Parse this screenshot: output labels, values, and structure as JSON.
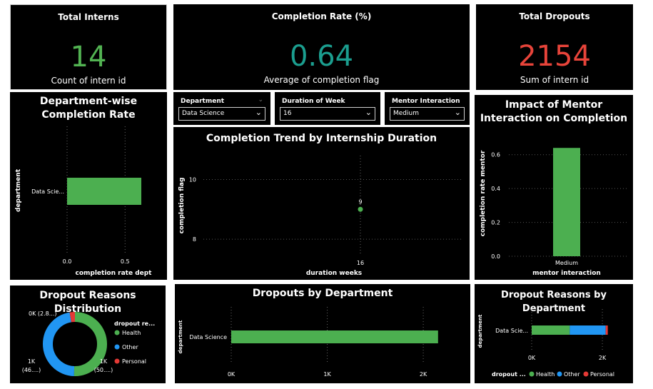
{
  "kpis": {
    "total_interns": {
      "title": "Total Interns",
      "value": "14",
      "subtitle": "Count of intern id",
      "color": "#52b352"
    },
    "completion_rate": {
      "title": "Completion Rate (%)",
      "value": "0.64",
      "subtitle": "Average of completion flag",
      "color": "#1b9e8f"
    },
    "total_dropouts": {
      "title": "Total Dropouts",
      "value": "2154",
      "subtitle": "Sum of intern id",
      "color": "#e8443a"
    }
  },
  "slicers": {
    "department": {
      "label": "Department",
      "value": "Data Science"
    },
    "duration": {
      "label": "Duration of Week",
      "value": "16"
    },
    "mentor": {
      "label": "Mentor Interaction",
      "value": "Medium"
    }
  },
  "colors": {
    "green": "#4caf50",
    "blue": "#2196f3",
    "red": "#e53935"
  },
  "chart_data": [
    {
      "id": "dept_completion",
      "type": "bar",
      "orientation": "horizontal",
      "title": "Department-wise Completion Rate",
      "xlabel": "completion rate dept",
      "ylabel": "department",
      "categories": [
        "Data Scie..."
      ],
      "values": [
        0.64
      ],
      "xlim": [
        0,
        0.8
      ],
      "xticks": [
        "0.0",
        "0.5"
      ],
      "xtick_values": [
        0.0,
        0.5
      ]
    },
    {
      "id": "trend_duration",
      "type": "scatter",
      "title": "Completion Trend by Internship Duration",
      "xlabel": "duration weeks",
      "ylabel": "completion flag",
      "points": [
        {
          "x": 16,
          "y": 9,
          "label": "9"
        }
      ],
      "yticks": [
        "10",
        "8"
      ],
      "ytick_values": [
        10,
        8
      ],
      "xticks": [
        "16"
      ],
      "ylim": [
        7.5,
        10.8
      ]
    },
    {
      "id": "mentor_impact",
      "type": "bar",
      "title": "Impact of Mentor Interaction on Completion",
      "xlabel": "mentor interaction",
      "ylabel": "completion rate mentor",
      "categories": [
        "Medium"
      ],
      "values": [
        0.64
      ],
      "yticks": [
        "0.6",
        "0.4",
        "0.2",
        "0.0"
      ],
      "ytick_values": [
        0.6,
        0.4,
        0.2,
        0.0
      ],
      "ylim": [
        0,
        0.7
      ]
    },
    {
      "id": "dropout_reasons",
      "type": "pie",
      "title": "Dropout Reasons Distribution",
      "legend_title": "dropout re...",
      "slices": [
        {
          "name": "Health",
          "value": 1077,
          "label": "1K\n(50....)"
        },
        {
          "name": "Other",
          "value": 1000,
          "label": "1K\n(46....)"
        },
        {
          "name": "Personal",
          "value": 60,
          "label": "0K (2.8...)"
        }
      ]
    },
    {
      "id": "dropouts_dept",
      "type": "bar",
      "orientation": "horizontal",
      "title": "Dropouts by Department",
      "ylabel": "department",
      "categories": [
        "Data Science"
      ],
      "values": [
        2154
      ],
      "xticks": [
        "0K",
        "1K",
        "2K"
      ],
      "xtick_values": [
        0,
        1000,
        2000
      ],
      "xlim": [
        0,
        2300
      ]
    },
    {
      "id": "reasons_dept",
      "type": "bar",
      "orientation": "horizontal",
      "stacked": true,
      "title": "Dropout Reasons by Department",
      "ylabel": "department",
      "legend_title": "dropout ...",
      "categories": [
        "Data Scie..."
      ],
      "series": [
        {
          "name": "Health",
          "values": [
            1077
          ]
        },
        {
          "name": "Other",
          "values": [
            1017
          ]
        },
        {
          "name": "Personal",
          "values": [
            60
          ]
        }
      ],
      "xticks": [
        "0K",
        "2K"
      ],
      "xtick_values": [
        0,
        2000
      ],
      "xlim": [
        0,
        2300
      ]
    }
  ]
}
